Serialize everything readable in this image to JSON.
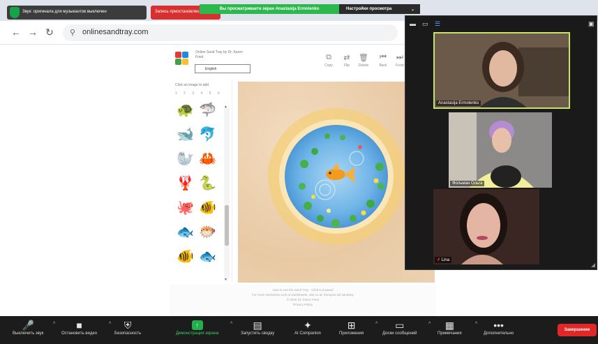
{
  "zoom_top": {
    "music_mode_label": "Звук: оригинала для музыкантов выключен",
    "record_label": "Запись приостановлена",
    "share_banner": "Вы просматриваете экран Anastasija Ermolenko",
    "view_options": "Настройки просмотра"
  },
  "browser": {
    "url": "onlinesandtray.com"
  },
  "sandtray": {
    "title": "Online Sand Tray by Dr. Karen Fried",
    "language": "English",
    "panel_hint": "Click an image to add",
    "numbers": "1 2 3 4 5 6",
    "tools": [
      {
        "icon": "copy-icon",
        "glyph": "⧉",
        "label": "Copy"
      },
      {
        "icon": "flip-icon",
        "glyph": "⇄",
        "label": "Flip"
      },
      {
        "icon": "delete-icon",
        "glyph": "🗑",
        "label": "Delete"
      },
      {
        "icon": "back-icon",
        "glyph": "⏮",
        "label": "Back"
      },
      {
        "icon": "front-icon",
        "glyph": "⏭",
        "label": "Front"
      }
    ],
    "figures": [
      "🐢",
      "🦈",
      "🐋",
      "🐬",
      "🦭",
      "🦀",
      "🦞",
      "🐍",
      "🐙",
      "🐠",
      "🐟",
      "🐡",
      "🐠",
      "🐟"
    ],
    "footer_lines": [
      "How to use the Sand Tray - Click to Expand",
      "For more interactive tools & worksheets, visit us at: therapist aid sandtray",
      "© 2020 Dr. Karen Fried",
      "Privacy Policy"
    ]
  },
  "gallery": {
    "participants": [
      {
        "name": "Anastasija Ermolenko",
        "active": true
      },
      {
        "name": "Фольман Ольга",
        "active": false
      },
      {
        "name": "Lina",
        "active": false
      }
    ]
  },
  "toolbar": {
    "items": [
      {
        "icon": "microphone-icon",
        "glyph": "🎤",
        "label": "Выключить звук",
        "caret": true
      },
      {
        "icon": "video-camera-icon",
        "glyph": "■",
        "label": "Остановить видео",
        "caret": true
      },
      {
        "icon": "security-shield-icon",
        "glyph": "⛨",
        "label": "Безопасность",
        "caret": false
      },
      {
        "icon": "share-screen-icon",
        "glyph": "↑",
        "label": "Демонстрация экрана",
        "caret": true
      },
      {
        "icon": "summary-icon",
        "glyph": "▤",
        "label": "Запустить сводку",
        "caret": false
      },
      {
        "icon": "ai-companion-icon",
        "glyph": "✦",
        "label": "AI Companion",
        "caret": false
      },
      {
        "icon": "apps-icon",
        "glyph": "⊞",
        "label": "Приложения",
        "caret": true
      },
      {
        "icon": "whiteboard-icon",
        "glyph": "▭",
        "label": "Доски сообщений",
        "caret": true
      },
      {
        "icon": "notes-icon",
        "glyph": "▦",
        "label": "Примечания",
        "caret": true
      },
      {
        "icon": "more-icon",
        "glyph": "•••",
        "label": "Дополнительно",
        "caret": false
      }
    ],
    "end_label": "Завершение"
  }
}
